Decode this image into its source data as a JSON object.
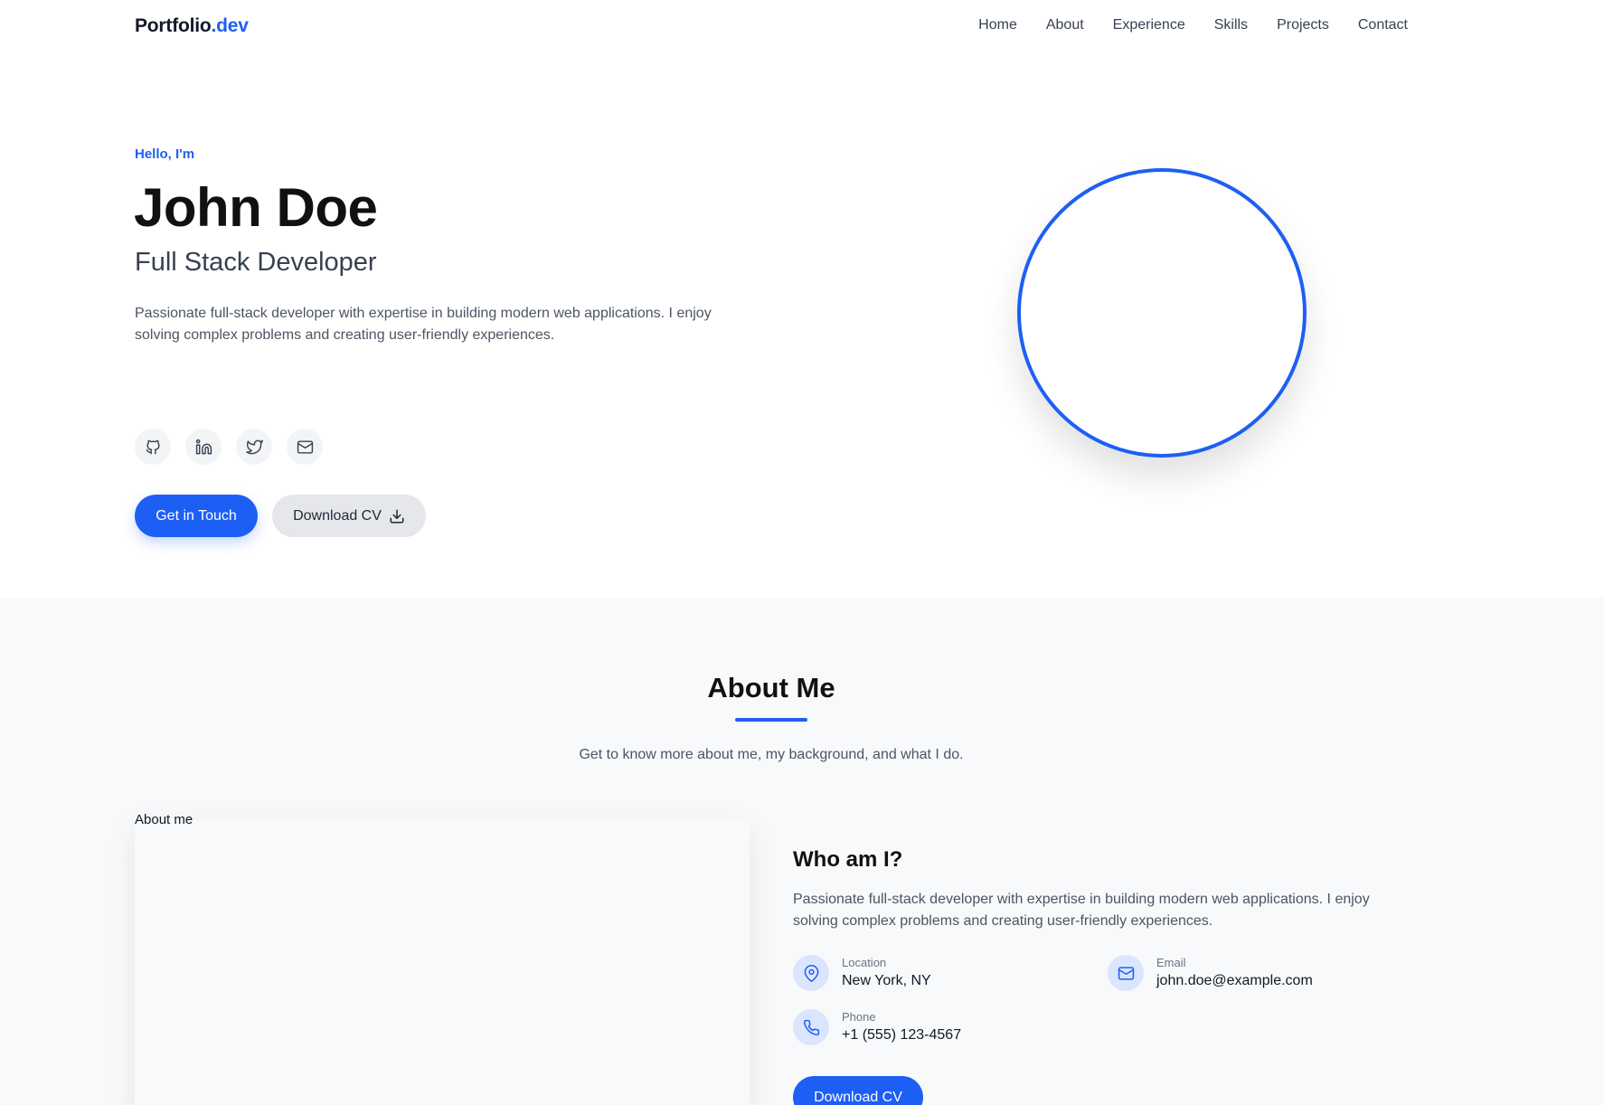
{
  "nav": {
    "brand_name": "Portfolio",
    "brand_tld": ".dev",
    "links": [
      "Home",
      "About",
      "Experience",
      "Skills",
      "Projects",
      "Contact"
    ]
  },
  "hero": {
    "greeting": "Hello, I'm",
    "name": "John Doe",
    "role": "Full Stack Developer",
    "bio": "Passionate full-stack developer with expertise in building modern web applications. I enjoy solving complex problems and creating user-friendly experiences.",
    "socials": [
      "github-icon",
      "linkedin-icon",
      "twitter-icon",
      "mail-icon"
    ],
    "primary_button": "Get in Touch",
    "secondary_button": "Download CV"
  },
  "about": {
    "title": "About Me",
    "subtitle": "Get to know more about me, my background, and what I do.",
    "image_alt": "About me",
    "who_title": "Who am I?",
    "who_text": "Passionate full-stack developer with expertise in building modern web applications. I enjoy solving complex problems and creating user-friendly experiences.",
    "location_label": "Location",
    "location_value": "New York, NY",
    "email_label": "Email",
    "email_value": "john.doe@example.com",
    "phone_label": "Phone",
    "phone_value": "+1 (555) 123-4567",
    "button": "Download CV"
  },
  "colors": {
    "accent": "#1d5ff5",
    "section_bg": "#f8f9fb"
  }
}
